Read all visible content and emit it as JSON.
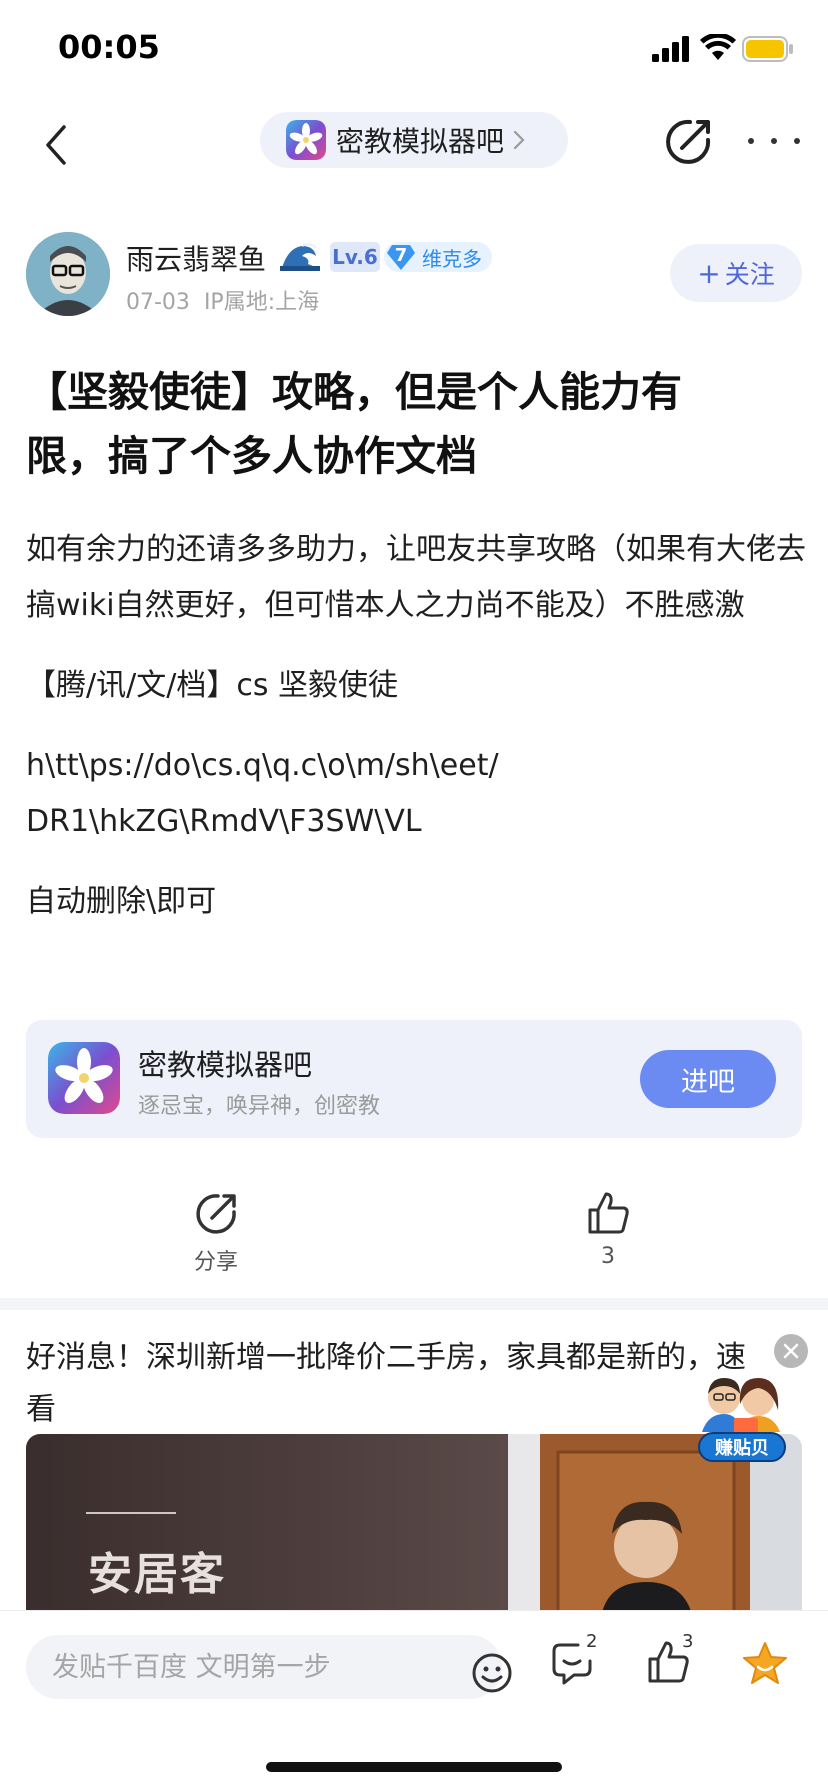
{
  "status_bar": {
    "time": "00:05",
    "icons": [
      "signal-icon",
      "wifi-icon",
      "battery-icon"
    ]
  },
  "nav": {
    "forum_name": "密教模拟器吧",
    "icons": [
      "back-arrow-icon",
      "forum-logo-icon",
      "chevron-right-icon",
      "compose-icon",
      "more-icon"
    ]
  },
  "author": {
    "name": "雨云翡翠鱼",
    "level": "Lv.6",
    "member_level": "7",
    "member_label": "维克多",
    "date": "07-03",
    "ip_location": "IP属地:上海",
    "follow_plus": "+",
    "follow_label": "关注"
  },
  "post": {
    "title": "【坚毅使徒】攻略，但是个人能力有限，搞了个多人协作文档",
    "paragraphs": [
      "如有余力的还请多多助力，让吧友共享攻略（如果有大佬去搞wiki自然更好，但可惜本人之力尚不能及）不胜感激",
      "【腾/讯/文/档】cs 坚毅使徒",
      "h\\tt\\ps://do\\cs.q\\q.c\\o\\m/sh\\eet/\nDR1\\hkZG\\RmdV\\F3SW\\VL",
      "自动删除\\即可"
    ]
  },
  "forum_card": {
    "name": "密教模拟器吧",
    "slogan": "逐忌宝，唤异神，创密教",
    "enter_label": "进吧"
  },
  "actions": {
    "share_label": "分享",
    "like_count": "3"
  },
  "ad": {
    "title": "好消息！深圳新增一批降价二手房，家具都是新的，速看",
    "brand": "安居客",
    "sticker_label": "赚贴贝"
  },
  "bottom_bar": {
    "reply_placeholder": "发贴千百度 文明第一步",
    "comment_count": "2",
    "like_count": "3"
  },
  "colors": {
    "accent": "#6b8af2",
    "follow_text": "#4f67d8",
    "pill_bg": "#eef1fa",
    "favorite": "#f5a623"
  }
}
